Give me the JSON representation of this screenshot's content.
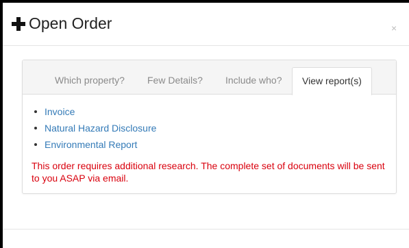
{
  "modal": {
    "title": "Open Order",
    "close_label": "×"
  },
  "tabs": [
    {
      "label": "Which property?",
      "active": false
    },
    {
      "label": "Few Details?",
      "active": false
    },
    {
      "label": "Include who?",
      "active": false
    },
    {
      "label": "View report(s)",
      "active": true
    }
  ],
  "reports": [
    {
      "label": "Invoice"
    },
    {
      "label": "Natural Hazard Disclosure"
    },
    {
      "label": "Environmental Report"
    }
  ],
  "notice": "This order requires additional research. The complete set of documents will be sent to you ASAP via email.",
  "colors": {
    "link": "#337ab7",
    "notice": "#d9000d",
    "tab_inactive": "#8a8a8a",
    "frame": "#000000"
  },
  "icons": {
    "title_icon": "plus-icon",
    "close_icon": "close-icon"
  }
}
